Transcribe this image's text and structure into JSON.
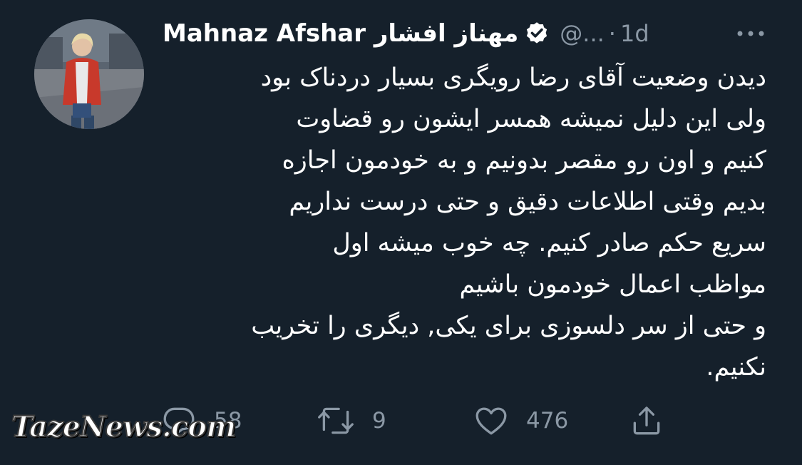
{
  "tweet": {
    "display_name": "Mahnaz Afshar مهناز افشار",
    "handle": "@...",
    "separator": "·",
    "time": "1d",
    "body_lines": [
      "دیدن وضعیت آقای رضا رویگری بسیار دردناک بود",
      "ولی این دلیل نمیشه همسر ایشون رو قضاوت",
      "کنیم و اون رو مقصر بدونیم و به خودمون اجازه",
      "بدیم وقتی اطلاعات دقیق و حتی درست نداریم",
      "سریع حکم صادر کنیم. چه خوب میشه اول",
      "مواظب اعمال خودمون باشیم",
      "و حتی از سر دلسوزی برای یکی, دیگری را تخریب",
      "نکنیم."
    ]
  },
  "actions": {
    "reply_count": "58",
    "retweet_count": "9",
    "like_count": "476"
  },
  "icons": {
    "verified": "verified-badge-icon",
    "more": "more-options-icon",
    "reply": "reply-icon",
    "retweet": "retweet-icon",
    "like": "heart-icon",
    "share": "share-icon"
  },
  "colors": {
    "background": "#15202b",
    "text": "#ffffff",
    "secondary": "#8b98a5"
  },
  "watermark": "TazeNews.com"
}
